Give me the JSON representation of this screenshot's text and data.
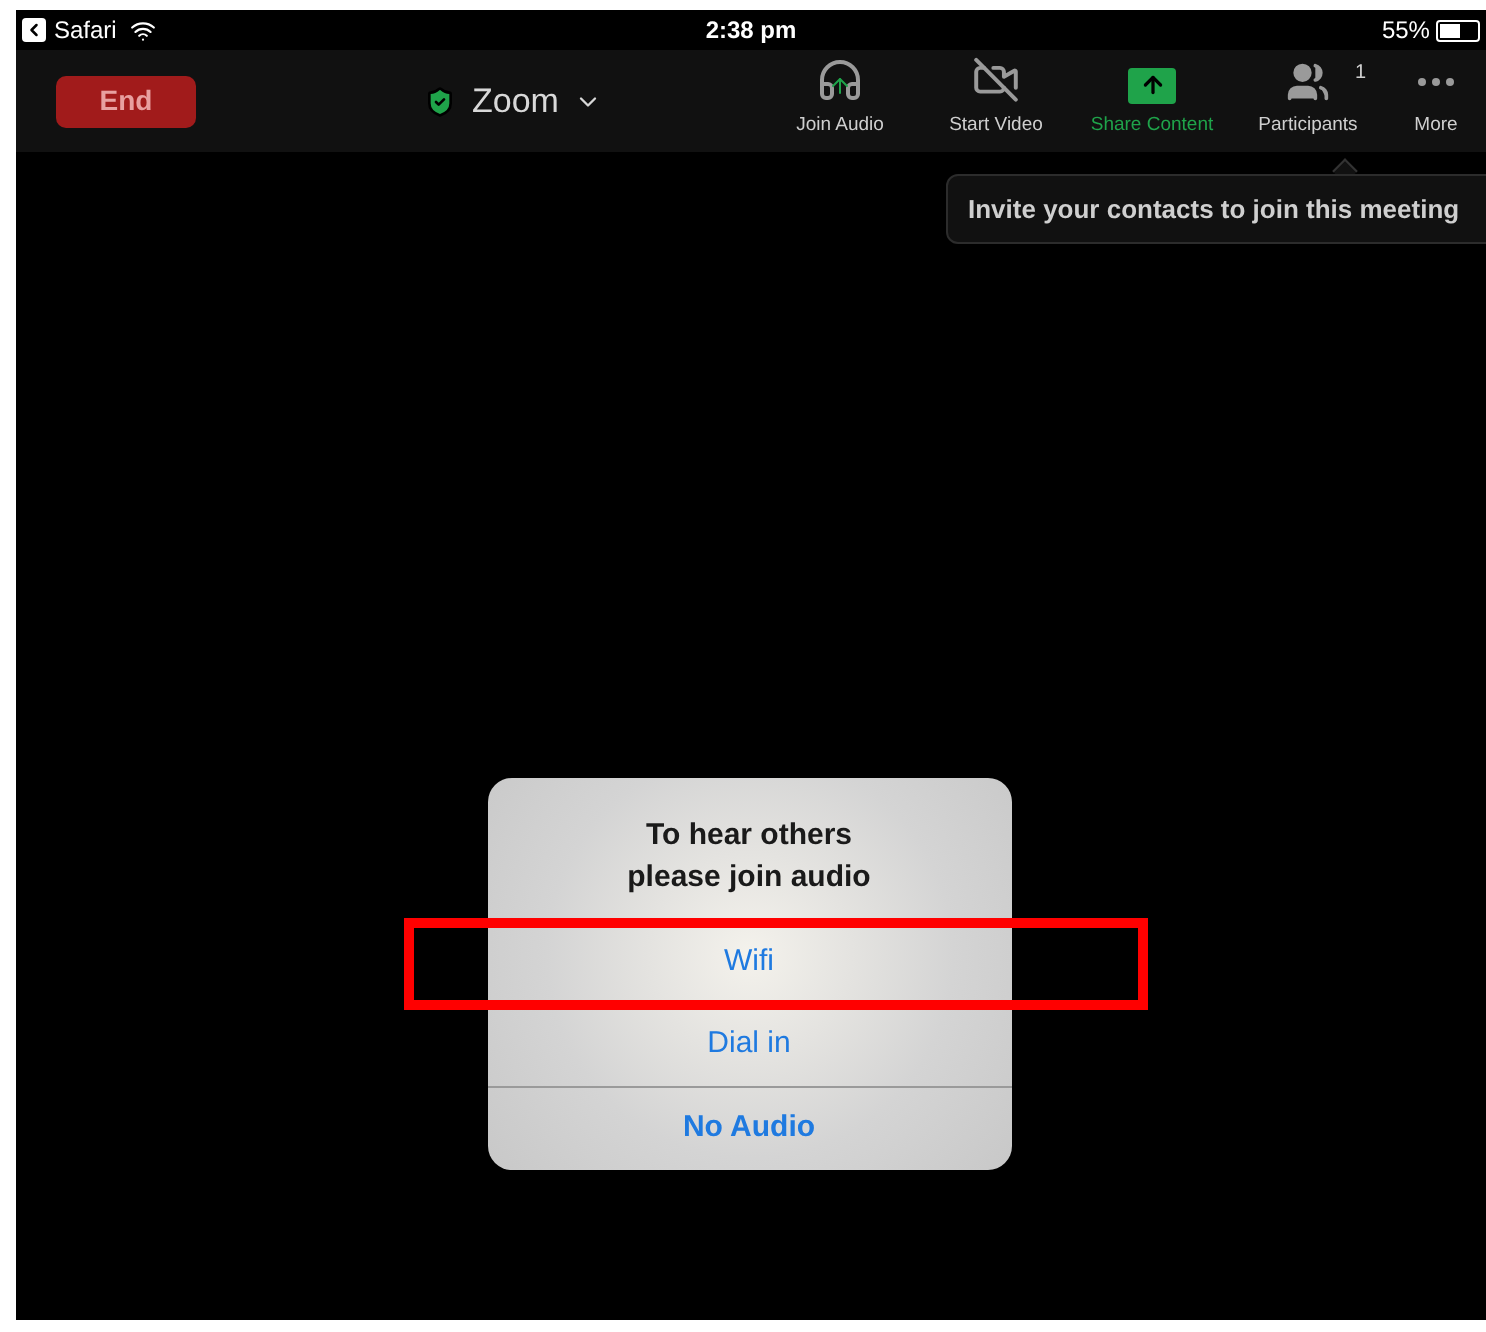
{
  "status_bar": {
    "back_app": "Safari",
    "time": "2:38 pm",
    "battery": "55%"
  },
  "toolbar": {
    "end_button": "End",
    "meeting_title": "Zoom",
    "items": [
      {
        "kind": "audio",
        "label": "Join Audio",
        "active": false
      },
      {
        "kind": "video",
        "label": "Start Video",
        "active": false
      },
      {
        "kind": "share",
        "label": "Share Content",
        "active": true
      },
      {
        "kind": "participants",
        "label": "Participants",
        "active": false,
        "count": "1"
      },
      {
        "kind": "more",
        "label": "More",
        "active": false
      }
    ]
  },
  "tooltip": "Invite your contacts to join this meeting",
  "dialog": {
    "title": "To hear others please join audio",
    "options": [
      {
        "label": "Wifi",
        "highlighted": true,
        "bold": false
      },
      {
        "label": "Dial in",
        "highlighted": false,
        "bold": false
      },
      {
        "label": "No Audio",
        "highlighted": false,
        "bold": true
      }
    ]
  }
}
